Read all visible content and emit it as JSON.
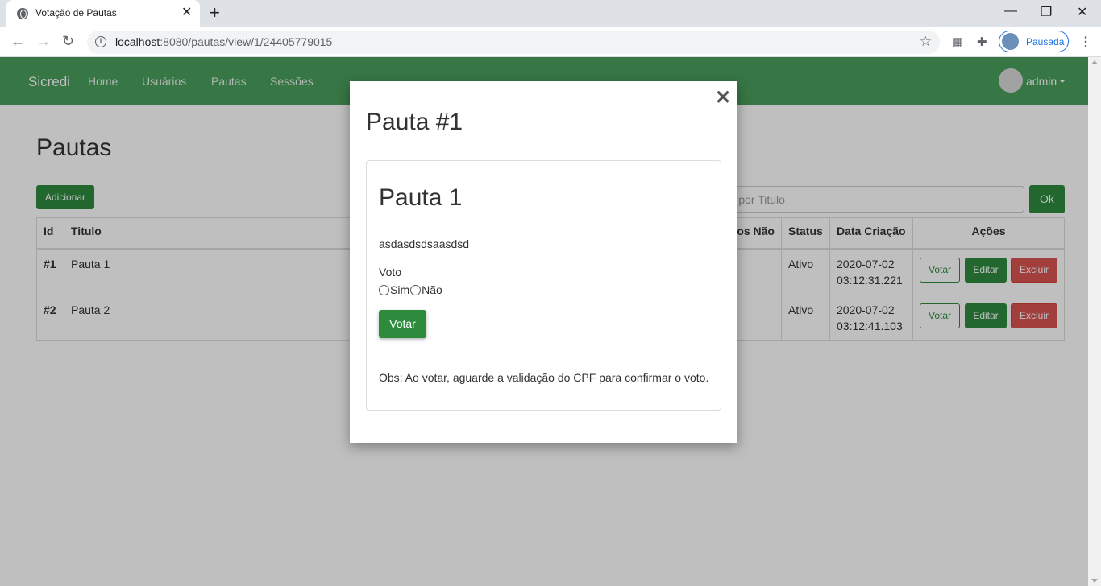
{
  "browser": {
    "tab_title": "Votação de Pautas",
    "tab_close": "✕",
    "new_tab": "+",
    "url_host": "localhost",
    "url_path": ":8080/pautas/view/1/24405779015",
    "profile_label": "Pausada",
    "back": "←",
    "forward": "→",
    "reload": "↻",
    "star": "☆",
    "minimize": "—",
    "restore": "❐",
    "close": "✕",
    "menu": "⋮"
  },
  "navbar": {
    "brand": "Sicredi",
    "links": [
      "Home",
      "Usuários",
      "Pautas",
      "Sessões"
    ],
    "user": "admin"
  },
  "page": {
    "title": "Pautas",
    "add_button": "Adicionar",
    "search_placeholder": "zar por Titulo",
    "ok_button": "Ok",
    "columns": [
      "Id",
      "Titulo",
      "os Não",
      "Status",
      "Data Criação",
      "Ações"
    ],
    "rows": [
      {
        "id": "#1",
        "titulo": "Pauta 1",
        "status": "Ativo",
        "date": "2020-07-02",
        "time": "03:12:31.221"
      },
      {
        "id": "#2",
        "titulo": "Pauta 2",
        "status": "Ativo",
        "date": "2020-07-02",
        "time": "03:12:41.103"
      }
    ],
    "actions": {
      "votar": "Votar",
      "editar": "Editar",
      "excluir": "Excluir"
    }
  },
  "modal": {
    "title": "Pauta #1",
    "close": "✕",
    "pauta_title": "Pauta 1",
    "description": "asdasdsdsaasdsd",
    "vote_label": "Voto",
    "option_yes": "Sim",
    "option_no": "Não",
    "vote_button": "Votar",
    "note": "Obs: Ao votar, aguarde a validação do CPF para confirmar o voto."
  }
}
